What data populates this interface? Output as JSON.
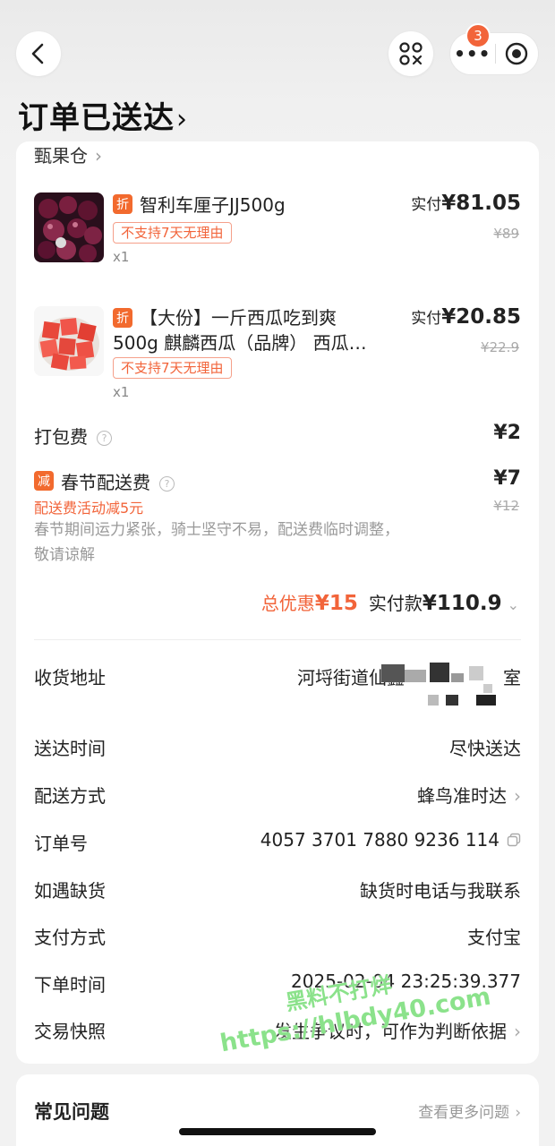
{
  "nav": {
    "badge_count": "3",
    "more_label": "•••"
  },
  "title": "订单已送达",
  "store": {
    "name": "甄果仓"
  },
  "products": [
    {
      "tag": "折",
      "name": "智利车厘子JJ500g",
      "no_return": "不支持7天无理由",
      "qty": "x1",
      "paid_label": "实付",
      "paid_amount": "¥81.05",
      "orig_price": "¥89"
    },
    {
      "tag": "折",
      "name_line1": "【大份】一斤西瓜吃到爽",
      "name_line2": "500g 麒麟西瓜（品牌） 西瓜…",
      "no_return": "不支持7天无理由",
      "qty": "x1",
      "paid_label": "实付",
      "paid_amount": "¥20.85",
      "orig_price": "¥22.9"
    }
  ],
  "fees": {
    "packing_label": "打包费",
    "packing_amount": "¥2",
    "delivery_tag": "减",
    "delivery_label": "春节配送费",
    "delivery_amount": "¥7",
    "delivery_orig": "¥12",
    "delivery_discount_note": "配送费活动减5元",
    "delivery_explain": "春节期间运力紧张，骑士坚守不易，配送费临时调整，敬请谅解"
  },
  "summary": {
    "discount_label": "总优惠",
    "discount_amount": "¥15",
    "pay_label": "实付款",
    "pay_amount": "¥110.9"
  },
  "info": {
    "address_label": "收货地址",
    "address_value": "河埒街道仙鑫",
    "address_suffix": "室",
    "delivery_time_label": "送达时间",
    "delivery_time_value": "尽快送达",
    "delivery_method_label": "配送方式",
    "delivery_method_value": "蜂鸟准时达",
    "order_no_label": "订单号",
    "order_no_value": "4057 3701 7880 9236 114",
    "stockout_label": "如遇缺货",
    "stockout_value": "缺货时电话与我联系",
    "payment_label": "支付方式",
    "payment_value": "支付宝",
    "order_time_label": "下单时间",
    "order_time_value": "2025-02-04 23:25:39.377",
    "snapshot_label": "交易快照",
    "snapshot_value": "发生争议时，可作为判断依据"
  },
  "watermark": {
    "line1": "黑料不打烊",
    "line2": "https://hlbdy40.com"
  },
  "faq": {
    "title": "常见问题",
    "more": "查看更多问题"
  }
}
